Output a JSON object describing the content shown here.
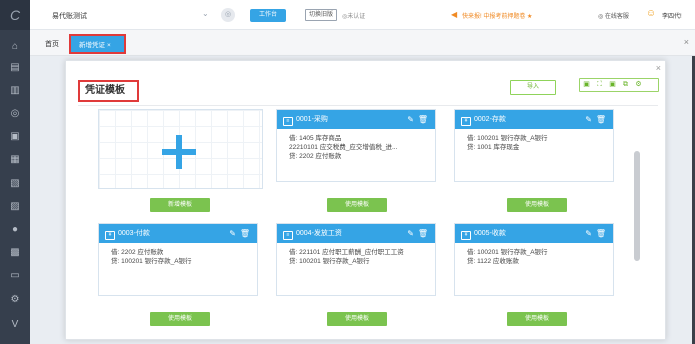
{
  "sidebar": {
    "logo": "C",
    "items": [
      {
        "icon": "home-icon",
        "glyph": "⌂"
      },
      {
        "icon": "voucher-icon",
        "glyph": "▤"
      },
      {
        "icon": "chart-icon",
        "glyph": "▥"
      },
      {
        "icon": "money-icon",
        "glyph": "◎"
      },
      {
        "icon": "invoice-icon",
        "glyph": "▣"
      },
      {
        "icon": "ledger-icon",
        "glyph": "▦"
      },
      {
        "icon": "report-icon",
        "glyph": "▧"
      },
      {
        "icon": "asset-icon",
        "glyph": "▨"
      },
      {
        "icon": "payroll-icon",
        "glyph": "●"
      },
      {
        "icon": "tax-icon",
        "glyph": "▩"
      },
      {
        "icon": "tool-icon",
        "glyph": "▭"
      },
      {
        "icon": "settings-icon",
        "glyph": "⚙"
      },
      {
        "icon": "expand-icon",
        "glyph": "V"
      }
    ]
  },
  "topbar": {
    "company": "易代账测试",
    "workbench_label": "工作台",
    "switch_label": "切换旧版",
    "unverified_label": "◎未认证",
    "promo_text": "快来报! 中报考前押题卷 ★",
    "service_label": "◎ 在线客服",
    "username": "李四代!"
  },
  "tabs": {
    "home": "首页",
    "active": "新增凭证",
    "active_close": "×",
    "close_all": "×"
  },
  "modal": {
    "close": "×",
    "title": "凭证模板",
    "import_label": "导入",
    "toolbar_icons": [
      "▣",
      "⛶",
      "▣",
      "⧉",
      "⚙"
    ]
  },
  "add_card": {
    "button_label": "新增模板"
  },
  "templates": [
    {
      "title": "0001-采购",
      "lines": [
        "借: 1405 库存商品",
        "22210101 应交税费_应交增值税_进...",
        "贷: 2202 应付账款"
      ],
      "button_label": "使用模板"
    },
    {
      "title": "0002-存款",
      "lines": [
        "借: 100201 银行存款_A银行",
        "贷: 1001 库存现金"
      ],
      "button_label": "使用模板"
    },
    {
      "title": "0003-付款",
      "lines": [
        "借: 2202 应付账款",
        "贷: 100201 银行存款_A银行"
      ],
      "button_label": "使用模板"
    },
    {
      "title": "0004-发放工资",
      "lines": [
        "借: 221101 应付职工薪酬_应付职工工资",
        "贷: 100201 银行存款_A银行"
      ],
      "button_label": "使用模板"
    },
    {
      "title": "0005-收款",
      "lines": [
        "借: 100201 银行存款_A银行",
        "贷: 1122 应收账款"
      ],
      "button_label": "使用模板"
    }
  ],
  "colors": {
    "accent": "#35a4e5",
    "green": "#7bc34f",
    "highlight": "#e03a3a",
    "sidebar": "#363f4d"
  }
}
